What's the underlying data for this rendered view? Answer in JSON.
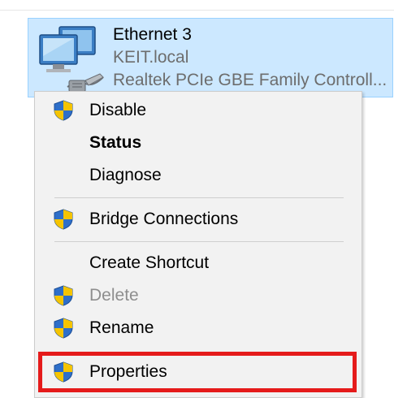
{
  "adapter": {
    "name": "Ethernet 3",
    "network": "KEIT.local",
    "device": "Realtek PCIe GBE Family Controll..."
  },
  "context_menu": {
    "items": [
      {
        "label": "Disable",
        "icon": "uac-shield-icon"
      },
      {
        "label": "Status",
        "bold": true
      },
      {
        "label": "Diagnose"
      },
      {
        "label": "Bridge Connections",
        "icon": "uac-shield-icon"
      },
      {
        "label": "Create Shortcut"
      },
      {
        "label": "Delete",
        "icon": "uac-shield-icon",
        "disabled": true
      },
      {
        "label": "Rename",
        "icon": "uac-shield-icon"
      },
      {
        "label": "Properties",
        "icon": "uac-shield-icon",
        "highlighted": true
      }
    ]
  },
  "colors": {
    "selection_bg": "#cce8ff",
    "menu_bg": "#f2f2f2",
    "highlight_border": "#e51b1b",
    "shield_blue": "#2e6fc9",
    "shield_yellow": "#f5c400"
  }
}
